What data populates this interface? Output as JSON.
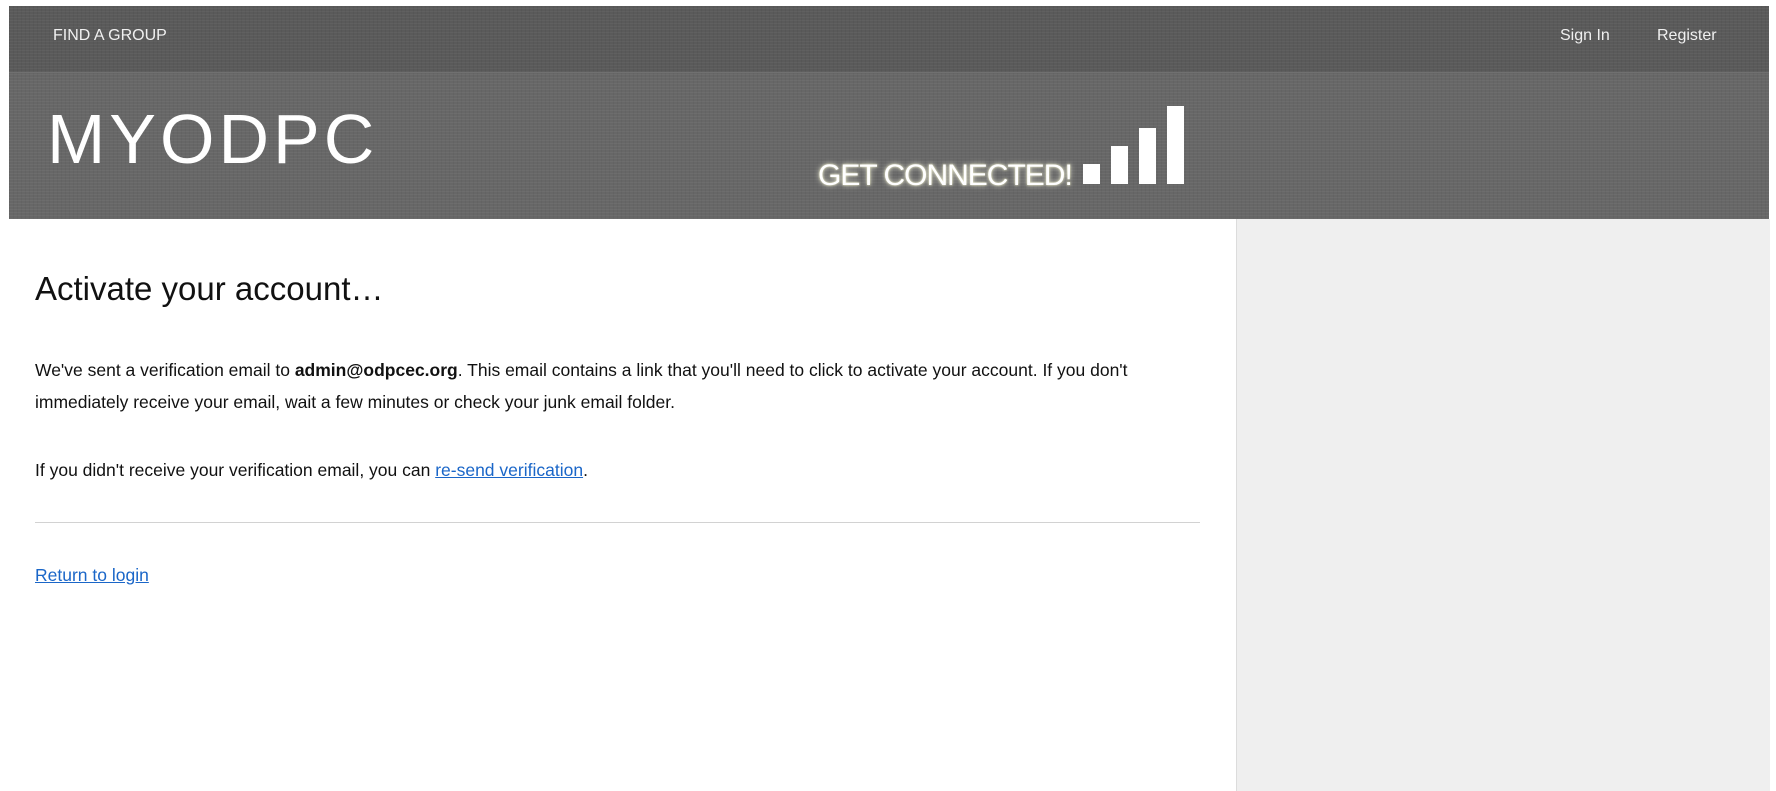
{
  "nav": {
    "find_group": "FIND A GROUP",
    "sign_in": "Sign In",
    "register": "Register"
  },
  "banner": {
    "logo": "MYODPC",
    "tagline": "GET CONNECTED!"
  },
  "main": {
    "title": "Activate your account…",
    "intro_before": "We've sent a verification email to ",
    "email": "admin@odpcec.org",
    "intro_after": ". This email contains a link that you'll need to click to activate your account. If you don't immediately receive your email, wait a few minutes or check your junk email folder.",
    "resend_before": "If you didn't receive your verification email, you can ",
    "resend_link": "re-send verification",
    "resend_after": ".",
    "return_link": "Return to login"
  },
  "colors": {
    "header_bg": "#5a5a5a",
    "banner_bg": "#676767",
    "link": "#1a66c8",
    "sidebar_bg": "#efefef"
  }
}
